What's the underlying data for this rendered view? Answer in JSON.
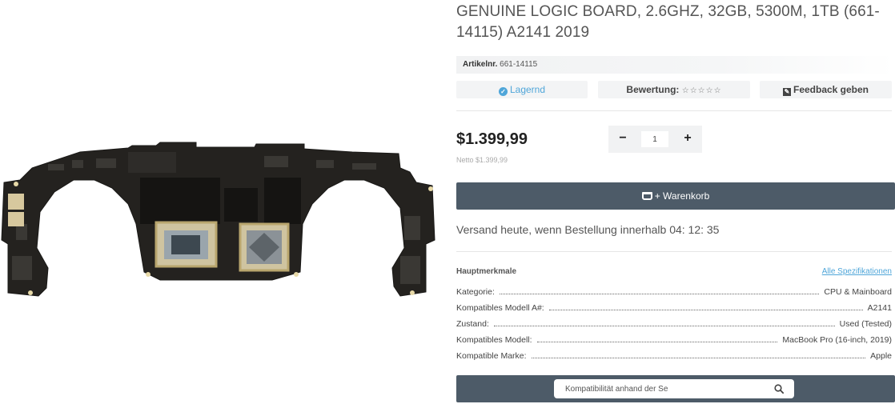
{
  "product": {
    "title": "GENUINE LOGIC BOARD, 2.6GHZ, 32GB, 5300M, 1TB (661-14115) A2141 2019",
    "artnr_label": "Artikelnr.",
    "artnr_value": "661-14115"
  },
  "status": {
    "stock_label": "Lagernd",
    "rating_label": "Bewertung:",
    "rating_stars": "☆☆☆☆☆",
    "feedback_label": "Feedback geben"
  },
  "pricing": {
    "price": "$1.399,99",
    "netto": "Netto $1.399,99",
    "quantity": "1",
    "minus_label": "−",
    "plus_label": "+"
  },
  "cart": {
    "label": "+ Warenkorb"
  },
  "shipping": {
    "text": "Versand heute, wenn Bestellung innerhalb 04: 12: 35"
  },
  "specs": {
    "heading": "Hauptmerkmale",
    "link": "Alle Spezifikationen",
    "rows": [
      {
        "key": "Kategorie:",
        "value": "CPU & Mainboard"
      },
      {
        "key": "Kompatibles Modell A#:",
        "value": "A2141"
      },
      {
        "key": "Zustand:",
        "value": "Used (Tested)"
      },
      {
        "key": "Kompatibles Modell:",
        "value": "MacBook Pro (16-inch, 2019)"
      },
      {
        "key": "Kompatible Marke:",
        "value": "Apple"
      }
    ]
  },
  "compat": {
    "placeholder": "Kompatibilität anhand der Se"
  },
  "colors": {
    "accent": "#4fa6d9",
    "button_bg": "#4d5b68",
    "board": "#24221f"
  }
}
